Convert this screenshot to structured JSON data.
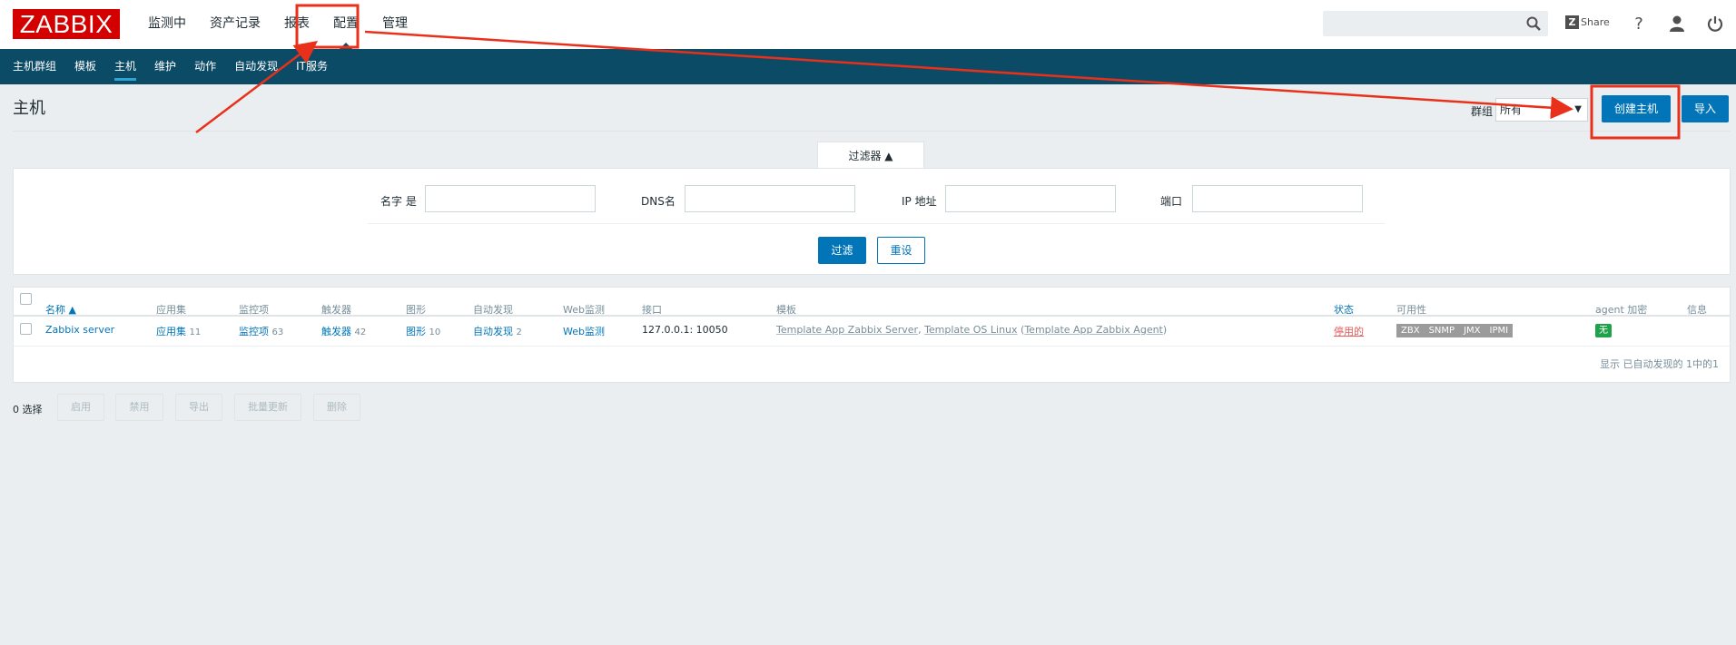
{
  "header": {
    "logo": "ZABBIX",
    "nav": [
      "监测中",
      "资产记录",
      "报表",
      "配置",
      "管理"
    ],
    "active_nav": "配置",
    "share_label": "Share",
    "icons": [
      "search-icon",
      "share-icon",
      "help-icon",
      "user-icon",
      "power-icon"
    ]
  },
  "subnav": {
    "items": [
      "主机群组",
      "模板",
      "主机",
      "维护",
      "动作",
      "自动发现",
      "IT服务"
    ],
    "active": "主机"
  },
  "page": {
    "title": "主机",
    "group_label": "群组",
    "group_value": "所有",
    "create_button": "创建主机",
    "import_button": "导入"
  },
  "filter": {
    "tab_label": "过滤器 ▲",
    "name_label": "名字 是",
    "dns_label": "DNS名",
    "ip_label": "IP 地址",
    "port_label": "端口",
    "name_value": "",
    "dns_value": "",
    "ip_value": "",
    "port_value": "",
    "apply_button": "过滤",
    "reset_button": "重设"
  },
  "table": {
    "columns": [
      "名称 ▲",
      "应用集",
      "监控项",
      "触发器",
      "图形",
      "自动发现",
      "Web监测",
      "接口",
      "模板",
      "状态",
      "可用性",
      "agent 加密",
      "信息"
    ],
    "row": {
      "name": "Zabbix server",
      "apps_label": "应用集",
      "apps_count": "11",
      "items_label": "监控项",
      "items_count": "63",
      "triggers_label": "触发器",
      "triggers_count": "42",
      "graphs_label": "图形",
      "graphs_count": "10",
      "discovery_label": "自动发现",
      "discovery_count": "2",
      "web_label": "Web监测",
      "interface": "127.0.0.1: 10050",
      "template_1": "Template App Zabbix Server",
      "template_sep": ", ",
      "template_2": "Template OS Linux",
      "template_open": " (",
      "template_3": "Template App Zabbix Agent",
      "template_close": ")",
      "status": "停用的",
      "availability": [
        "ZBX",
        "SNMP",
        "JMX",
        "IPMI"
      ],
      "encryption": "无"
    },
    "footer": "显示 已自动发现的 1中的1"
  },
  "actions": {
    "selected": "0 选择",
    "buttons": [
      "启用",
      "禁用",
      "导出",
      "批量更新",
      "删除"
    ]
  },
  "colors": {
    "brand": "#d40000",
    "subnav_bg": "#0b4b66",
    "primary": "#0275b8",
    "disabled_status": "#e45959",
    "encryption_none": "#1fa24a",
    "annotation": "#e8301a"
  }
}
